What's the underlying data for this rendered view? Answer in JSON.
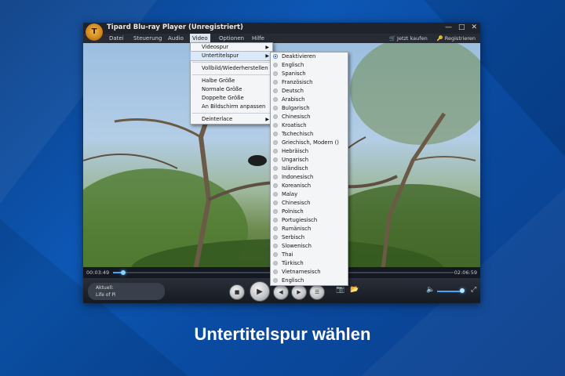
{
  "window": {
    "title": "Tipard Blu-ray Player (Unregistriert)",
    "controls": [
      "—",
      "□",
      "✕"
    ]
  },
  "menubar": {
    "items": [
      "Datei",
      "Steuerung",
      "Audio",
      "Video",
      "Optionen",
      "Hilfe"
    ],
    "active": "Video",
    "buy_label": "Jetzt kaufen",
    "register_label": "Registrieren",
    "buy_icon": "cart-icon",
    "register_icon": "key-icon"
  },
  "video_menu": {
    "items": [
      {
        "label": "Videospur",
        "submenu": true
      },
      {
        "label": "Untertitelspur",
        "submenu": true,
        "highlighted": true
      },
      {
        "label": "Vollbild/Wiederherstellen"
      },
      {
        "label": "Halbe Größe"
      },
      {
        "label": "Normale Größe"
      },
      {
        "label": "Doppelte Größe"
      },
      {
        "label": "An Bildschirm anpassen"
      },
      {
        "label": "Deinterlace",
        "submenu": true
      }
    ]
  },
  "subtitle_menu": {
    "selected": "Deaktivieren",
    "items": [
      "Deaktivieren",
      "Englisch",
      "Spanisch",
      "Französisch",
      "Deutsch",
      "Arabisch",
      "Bulgarisch",
      "Chinesisch",
      "Kroatisch",
      "Tschechisch",
      "Griechisch, Modern ()",
      "Hebräisch",
      "Ungarisch",
      "Isländisch",
      "Indonesisch",
      "Koreanisch",
      "Malay",
      "Chinesisch",
      "Polnisch",
      "Portugiesisch",
      "Rumänisch",
      "Serbisch",
      "Slowenisch",
      "Thai",
      "Türkisch",
      "Vietnamesisch",
      "Englisch"
    ]
  },
  "playback": {
    "elapsed": "00:03:49",
    "total": "02:06:59",
    "progress_fraction": 0.03
  },
  "now_playing": {
    "label": "Aktuell:",
    "title": "Life of Pi"
  },
  "volume": {
    "level_fraction": 0.9
  },
  "caption": "Untertitelspur wählen"
}
